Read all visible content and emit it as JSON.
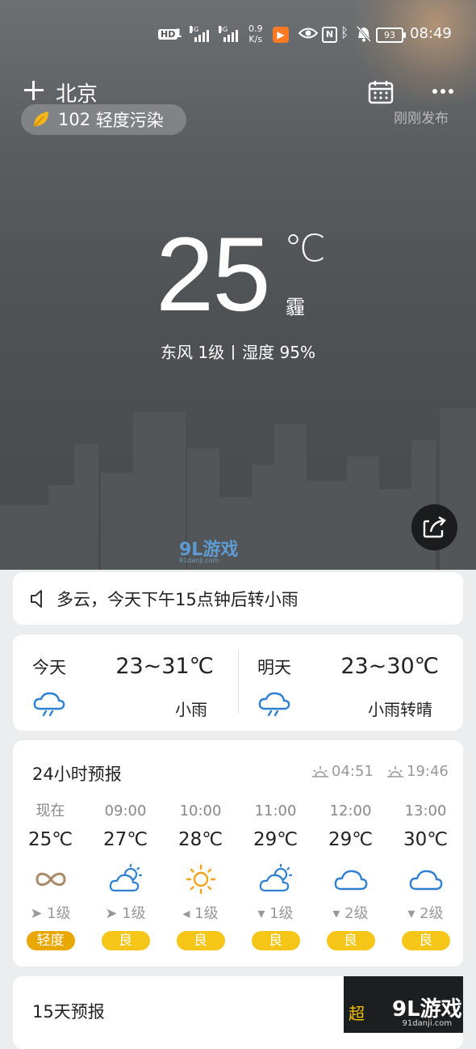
{
  "status_bar": {
    "hd": "HD",
    "sim1": "1",
    "net_type_1": "4G",
    "net_type_2": "3G",
    "speed_value": "0.9",
    "speed_unit": "K/s",
    "nfc": "N",
    "battery": "93",
    "time": "08:49"
  },
  "header": {
    "city": "北京",
    "aqi_value": "102",
    "aqi_label": "轻度污染",
    "published": "刚刚发布"
  },
  "current": {
    "temperature": "25",
    "unit": "℃",
    "condition": "霾",
    "wind": "东风 1级",
    "humidity": "湿度 95%"
  },
  "notice": {
    "text": "多云，今天下午15点钟后转小雨"
  },
  "daily": [
    {
      "label": "今天",
      "range": "23~31℃",
      "desc": "小雨",
      "icon": "rain-cloud-icon"
    },
    {
      "label": "明天",
      "range": "23~30℃",
      "desc": "小雨转晴",
      "icon": "rain-cloud-icon"
    }
  ],
  "hourly": {
    "title": "24小时预报",
    "sunrise": "04:51",
    "sunset": "19:46",
    "items": [
      {
        "time": "现在",
        "temp": "25℃",
        "icon": "haze-icon",
        "wind": "1级",
        "aqi": "轻度",
        "aqi_color": "#e9a800"
      },
      {
        "time": "09:00",
        "temp": "27℃",
        "icon": "partly-cloudy-icon",
        "wind": "1级",
        "aqi": "良",
        "aqi_color": "#f5c518"
      },
      {
        "time": "10:00",
        "temp": "28℃",
        "icon": "sun-icon",
        "wind": "1级",
        "aqi": "良",
        "aqi_color": "#f5c518"
      },
      {
        "time": "11:00",
        "temp": "29℃",
        "icon": "partly-cloudy-icon",
        "wind": "1级",
        "aqi": "良",
        "aqi_color": "#f5c518"
      },
      {
        "time": "12:00",
        "temp": "29℃",
        "icon": "cloud-icon",
        "wind": "2级",
        "aqi": "良",
        "aqi_color": "#f5c518"
      },
      {
        "time": "13:00",
        "temp": "30℃",
        "icon": "cloud-icon",
        "wind": "2级",
        "aqi": "良",
        "aqi_color": "#f5c518"
      }
    ]
  },
  "forecast15": {
    "title": "15天预报",
    "more": "超"
  },
  "watermarks": {
    "mark": "9L游戏",
    "site": "91danji.com"
  },
  "colors": {
    "accent_blue": "#2f7fd3",
    "aqi_yellow": "#f5c518",
    "sun_orange": "#f3a41a"
  }
}
